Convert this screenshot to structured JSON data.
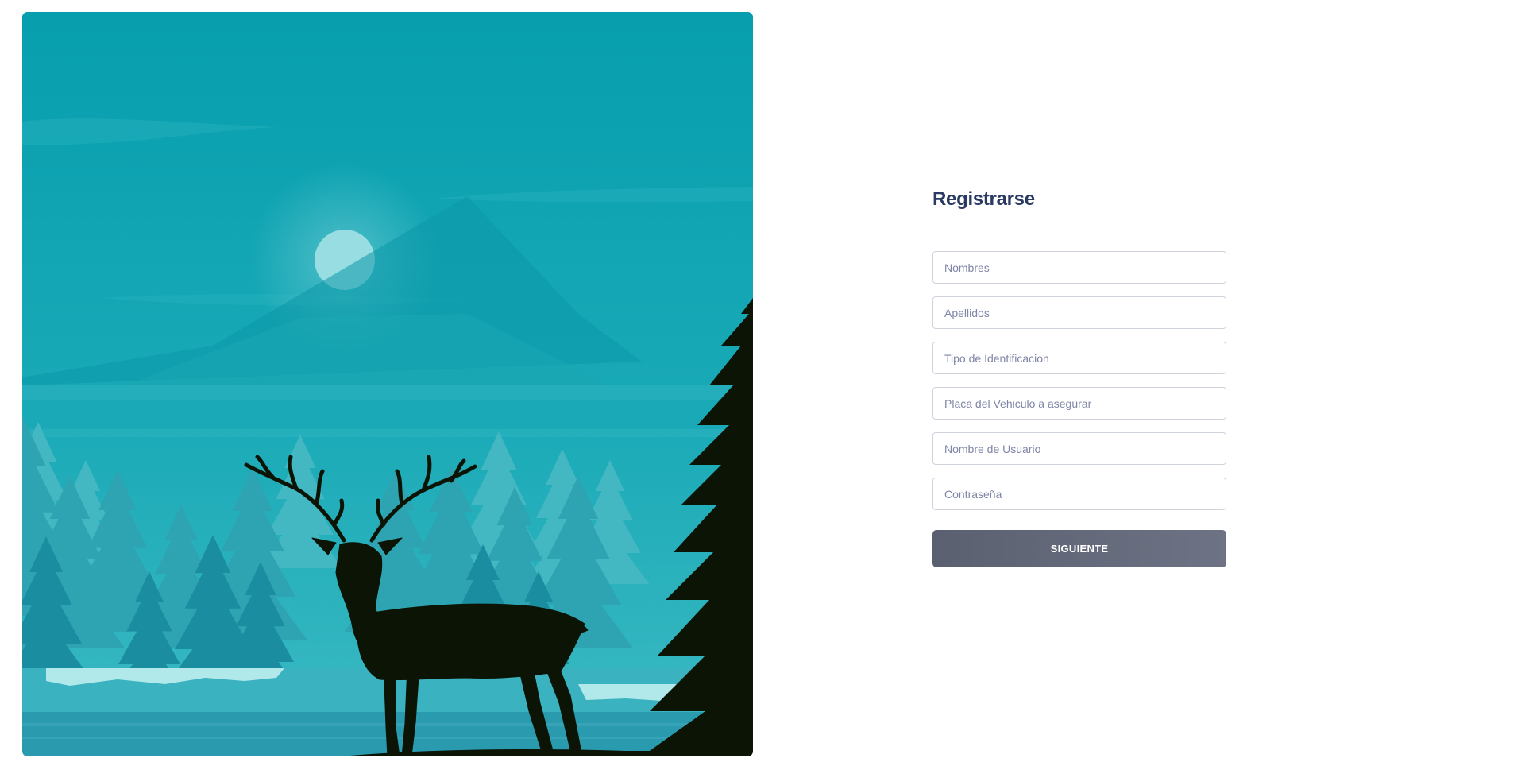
{
  "hero": {
    "image": "forest-deer-illustration",
    "colors": {
      "sky": "#0aa0af",
      "moon": "#98dde2",
      "silhouette": "#0b1405"
    }
  },
  "form": {
    "title": "Registrarse",
    "fields": [
      {
        "name": "nombres",
        "placeholder": "Nombres"
      },
      {
        "name": "apellidos",
        "placeholder": "Apellidos"
      },
      {
        "name": "tipo-identificacion",
        "placeholder": "Tipo de Identificacion"
      },
      {
        "name": "placa-vehiculo",
        "placeholder": "Placa del Vehiculo a asegurar"
      },
      {
        "name": "nombre-usuario",
        "placeholder": "Nombre de Usuario"
      },
      {
        "name": "contrasena",
        "placeholder": "Contraseña"
      }
    ],
    "submit_label": "SIGUIENTE",
    "colors": {
      "title": "#2b3a62",
      "button": "#5f6575"
    }
  }
}
